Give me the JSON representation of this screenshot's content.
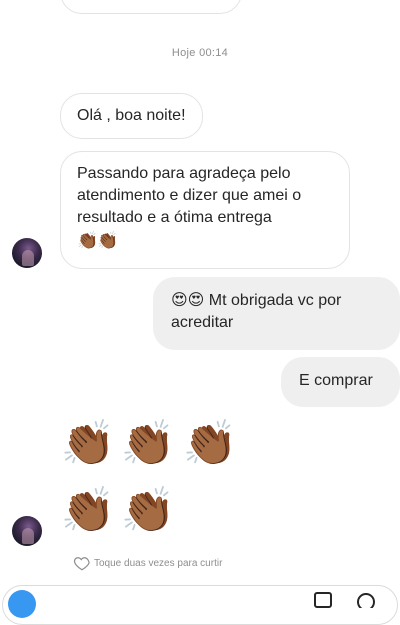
{
  "thread": {
    "timestamp": "Hoje 00:14",
    "messages": [
      {
        "from": "contact",
        "text": "Olá , boa noite!"
      },
      {
        "from": "contact",
        "lines": [
          "Passando para agradeça pelo",
          "atendimento e dizer que amei o",
          "resultado e a ótima entrega"
        ],
        "emojis": "👏🏾👏🏾"
      },
      {
        "from": "me",
        "line1": "😍😍 Mt obrigada vc por",
        "line2": "acreditar"
      },
      {
        "from": "me",
        "text": "E comprar"
      }
    ],
    "clap_emoji": "👏🏾",
    "like_hint": "Toque duas vezes para curtir"
  },
  "icons": {
    "avatar": "contact-avatar",
    "heart": "heart-outline-icon",
    "camera": "camera-icon",
    "gallery": "gallery-icon",
    "sticker": "sticker-icon"
  },
  "colors": {
    "bubble_incoming_border": "#e3e3e3",
    "bubble_outgoing_bg": "#efefef",
    "meta_text": "#8e8e8e",
    "accent": "#3897f0"
  }
}
